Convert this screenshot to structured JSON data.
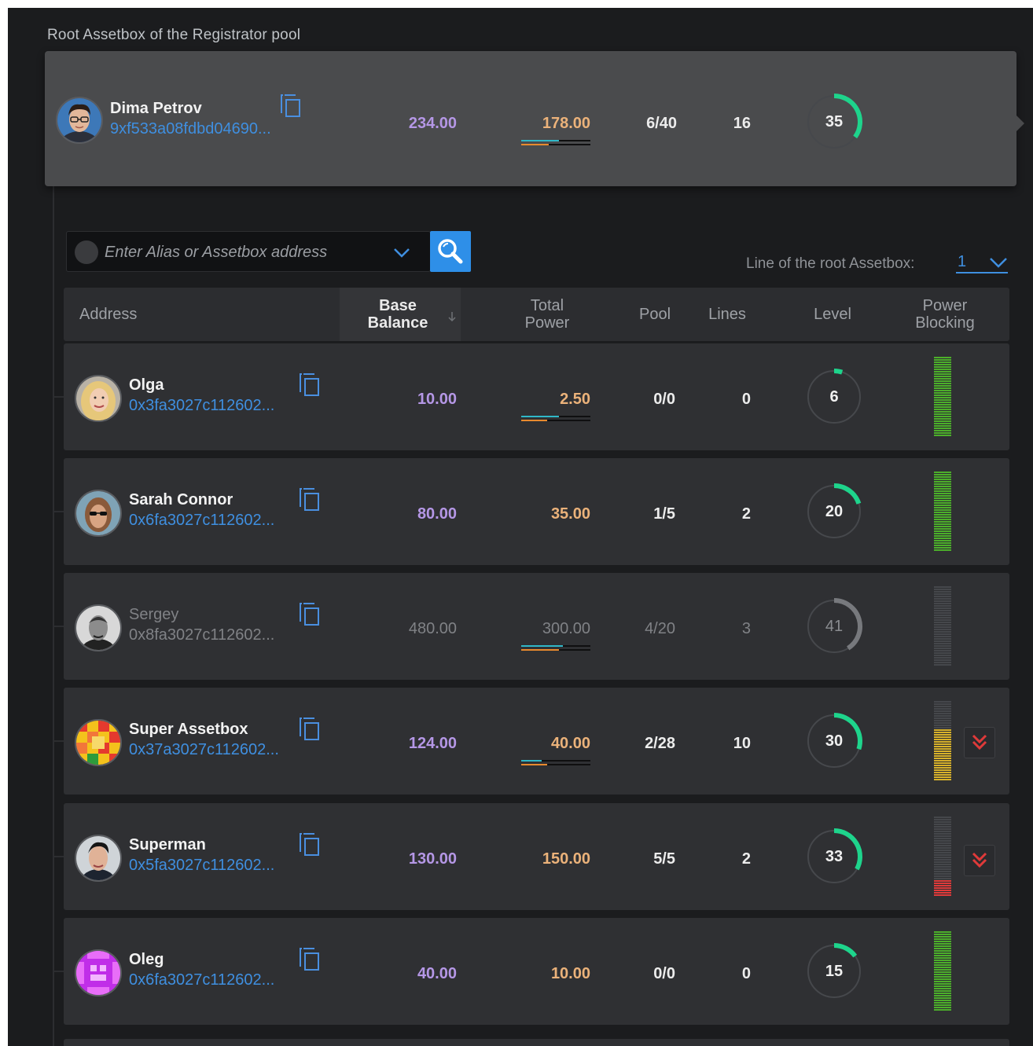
{
  "section_title": "Root Assetbox of the Registrator pool",
  "root": {
    "name": "Dima Petrov",
    "address": "9xf533a08fdbd04690...",
    "base_balance": "234.00",
    "total_power": "178.00",
    "power_bar_primary": 0.55,
    "power_bar_secondary": 0.4,
    "pool": "6/40",
    "lines": "16",
    "level": "35",
    "level_fraction": 0.35
  },
  "search": {
    "placeholder": "Enter Alias or Assetbox address",
    "value": ""
  },
  "line_selector": {
    "label": "Line of the root Assetbox:",
    "value": "1"
  },
  "table": {
    "headers": {
      "address": "Address",
      "base_balance_1": "Base",
      "base_balance_2": "Balance",
      "total_power_1": "Total",
      "total_power_2": "Power",
      "pool": "Pool",
      "lines": "Lines",
      "level": "Level",
      "power_blocking_1": "Power",
      "power_blocking_2": "Blocking"
    },
    "rows": [
      {
        "name": "Olga",
        "address": "0x3fa3027c112602...",
        "base_balance": "10.00",
        "total_power": "2.50",
        "has_power_bars": true,
        "power_bar_primary": 0.55,
        "power_bar_secondary": 0.38,
        "pool": "0/0",
        "lines": "0",
        "level": "6",
        "level_fraction": 0.05,
        "blocking_green": 1.0,
        "blocking_yellow": 0,
        "blocking_red": 0,
        "expandable": false,
        "dimmed": false
      },
      {
        "name": "Sarah Connor",
        "address": "0x6fa3027c112602...",
        "base_balance": "80.00",
        "total_power": "35.00",
        "has_power_bars": false,
        "pool": "1/5",
        "lines": "2",
        "level": "20",
        "level_fraction": 0.2,
        "blocking_green": 1.0,
        "blocking_yellow": 0,
        "blocking_red": 0,
        "expandable": false,
        "dimmed": false
      },
      {
        "name": "Sergey",
        "address": "0x8fa3027c112602...",
        "base_balance": "480.00",
        "total_power": "300.00",
        "has_power_bars": true,
        "power_bar_primary": 0.6,
        "power_bar_secondary": 0.55,
        "pool": "4/20",
        "lines": "3",
        "level": "41",
        "level_fraction": 0.41,
        "blocking_green": 0,
        "blocking_yellow": 0,
        "blocking_red": 0,
        "expandable": false,
        "dimmed": true
      },
      {
        "name": "Super Assetbox",
        "address": "0x37a3027c112602...",
        "base_balance": "124.00",
        "total_power": "40.00",
        "has_power_bars": true,
        "power_bar_primary": 0.3,
        "power_bar_secondary": 0.38,
        "pool": "2/28",
        "lines": "10",
        "level": "30",
        "level_fraction": 0.3,
        "blocking_green": 0,
        "blocking_yellow": 0.66,
        "blocking_red": 0,
        "expandable": true,
        "dimmed": false
      },
      {
        "name": "Superman",
        "address": "0x5fa3027c112602...",
        "base_balance": "130.00",
        "total_power": "150.00",
        "has_power_bars": false,
        "pool": "5/5",
        "lines": "2",
        "level": "33",
        "level_fraction": 0.33,
        "blocking_green": 0,
        "blocking_yellow": 0,
        "blocking_red": 0.22,
        "expandable": true,
        "dimmed": false
      },
      {
        "name": "Oleg",
        "address": "0x6fa3027c112602...",
        "base_balance": "40.00",
        "total_power": "10.00",
        "has_power_bars": false,
        "pool": "0/0",
        "lines": "0",
        "level": "15",
        "level_fraction": 0.15,
        "blocking_green": 1.0,
        "blocking_yellow": 0,
        "blocking_red": 0,
        "expandable": false,
        "dimmed": false
      }
    ]
  },
  "colors": {
    "accent_blue": "#3f8fe0",
    "gauge_green": "#1ed48c",
    "blocking_green": "#4caf2a",
    "blocking_yellow": "#d8b22a",
    "blocking_red": "#e03a3a",
    "base_balance": "#b597e6",
    "total_power": "#ebb27a"
  }
}
